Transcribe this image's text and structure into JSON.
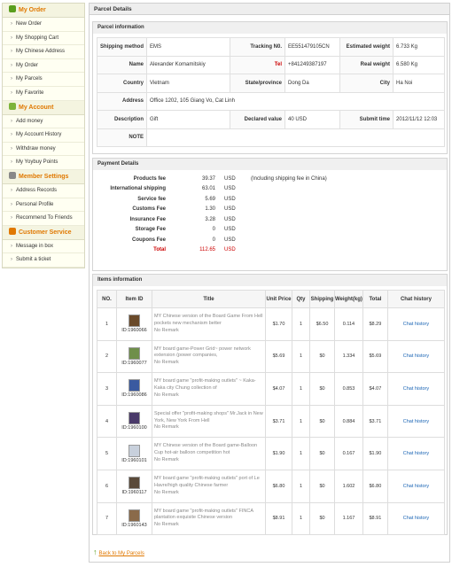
{
  "sidebar": {
    "sections": [
      {
        "title": "My Order",
        "icon": "basket-icon",
        "color": "#5a9e1e",
        "items": [
          "New Order",
          "My Shopping Cart",
          "My Chinese Address",
          "My Order",
          "My Parcels",
          "My Favorite"
        ]
      },
      {
        "title": "My Account",
        "icon": "account-icon",
        "color": "#7db33a",
        "items": [
          "Add money",
          "My Account History",
          "Withdraw money",
          "My Yoybuy Points"
        ]
      },
      {
        "title": "Member Settings",
        "icon": "gear-icon",
        "color": "#888888",
        "items": [
          "Address Records",
          "Personal Profile",
          "Recommend To Friends"
        ]
      },
      {
        "title": "Customer Service",
        "icon": "support-icon",
        "color": "#e07800",
        "items": [
          "Message in box",
          "Submit a ticket"
        ]
      }
    ]
  },
  "main": {
    "title": "Parcel Details"
  },
  "parcel": {
    "title": "Parcel information",
    "shipping_method_label": "Shipping method",
    "shipping_method": "EMS",
    "tracking_label": "Tracking N0.",
    "tracking": "EE551479105CN",
    "est_weight_label": "Estimated weight",
    "est_weight": "6.733 Kg",
    "name_label": "Name",
    "name": "Alexander Komamitskiy",
    "tel_label": "Tel",
    "tel": "+841249387197",
    "real_weight_label": "Real weight",
    "real_weight": "6.580 Kg",
    "country_label": "Country",
    "country": "Vietnam",
    "state_label": "State/province",
    "state": "Dong Da",
    "city_label": "City",
    "city": "Ha Noi",
    "address_label": "Address",
    "address": "Office 1202, 105 Giang Vo, Cat Linh",
    "description_label": "Description",
    "description": "Gift",
    "declared_label": "Declared value",
    "declared": "40 USD",
    "submit_time_label": "Submit time",
    "submit_time": "2012/11/12 12:03",
    "note_label": "NOTE",
    "note": ""
  },
  "payment": {
    "title": "Payment Details",
    "rows": [
      {
        "label": "Products fee",
        "value": "39.37",
        "unit": "USD",
        "note": "(Including shipping fee in China)"
      },
      {
        "label": "International shipping",
        "value": "63.01",
        "unit": "USD",
        "note": ""
      },
      {
        "label": "Service fee",
        "value": "5.69",
        "unit": "USD",
        "note": ""
      },
      {
        "label": "Customs Fee",
        "value": "1.30",
        "unit": "USD",
        "note": ""
      },
      {
        "label": "Insurance Fee",
        "value": "3.28",
        "unit": "USD",
        "note": ""
      },
      {
        "label": "Storage Fee",
        "value": "0",
        "unit": "USD",
        "note": ""
      },
      {
        "label": "Coupons Fee",
        "value": "0",
        "unit": "USD",
        "note": ""
      },
      {
        "label": "Total",
        "value": "112.65",
        "unit": "USD",
        "note": ""
      }
    ]
  },
  "items": {
    "title": "Items information",
    "headers": [
      "NO.",
      "Item ID",
      "Title",
      "Unit Price",
      "Qty",
      "Shipping",
      "Weight(kg)",
      "Total",
      "Chat history"
    ],
    "rows": [
      {
        "no": "1",
        "id": "ID:1960066",
        "title": "MY Chinese version of the Board Game From Hell pockets new mechanism better",
        "remark": "No Remark",
        "price": "$1.70",
        "qty": "1",
        "shipping": "$6.50",
        "weight": "0.114",
        "total": "$8.29",
        "chat": "Chat history",
        "thumb": "#6a4a2a"
      },
      {
        "no": "2",
        "id": "ID:1960077",
        "title": "MY board game-Power Grid~ power network extension (power companies,",
        "remark": "No Remark",
        "price": "$5.69",
        "qty": "1",
        "shipping": "$0",
        "weight": "1.334",
        "total": "$5.69",
        "chat": "Chat history",
        "thumb": "#6f8f4a"
      },
      {
        "no": "3",
        "id": "ID:1960086",
        "title": "MY board game \"profit-making outlets\" ~ Kaka-Kaka city Chung collection of",
        "remark": "No Remark",
        "price": "$4.07",
        "qty": "1",
        "shipping": "$0",
        "weight": "0.853",
        "total": "$4.07",
        "chat": "Chat history",
        "thumb": "#3a5aa0"
      },
      {
        "no": "4",
        "id": "ID:1960100",
        "title": "Special offer \"profit-making shops\" Mr.Jack in New York, New York From Hell",
        "remark": "No Remark",
        "price": "$3.71",
        "qty": "1",
        "shipping": "$0",
        "weight": "0.884",
        "total": "$3.71",
        "chat": "Chat history",
        "thumb": "#4a3a6a"
      },
      {
        "no": "5",
        "id": "ID:1960101",
        "title": "MY Chinese version of the Board game-Balloon Cup hot-air balloon competition hot",
        "remark": "No Remark",
        "price": "$1.90",
        "qty": "1",
        "shipping": "$0",
        "weight": "0.167",
        "total": "$1.90",
        "chat": "Chat history",
        "thumb": "#c8d0dc"
      },
      {
        "no": "6",
        "id": "ID:1960117",
        "title": "MY board game \"profit-making outlets\" port of Le Havre/high quality Chinese farmer",
        "remark": "No Remark",
        "price": "$6.80",
        "qty": "1",
        "shipping": "$0",
        "weight": "1.602",
        "total": "$6.80",
        "chat": "Chat history",
        "thumb": "#5a4a3a"
      },
      {
        "no": "7",
        "id": "ID:1960143",
        "title": "MY board game \"profit-making outlets\" FINCA plantation exquisite Chinese version",
        "remark": "No Remark",
        "price": "$8.91",
        "qty": "1",
        "shipping": "$0",
        "weight": "1.167",
        "total": "$8.91",
        "chat": "Chat history",
        "thumb": "#8a6a4a"
      }
    ]
  },
  "back_link": "Back to My Parcels"
}
